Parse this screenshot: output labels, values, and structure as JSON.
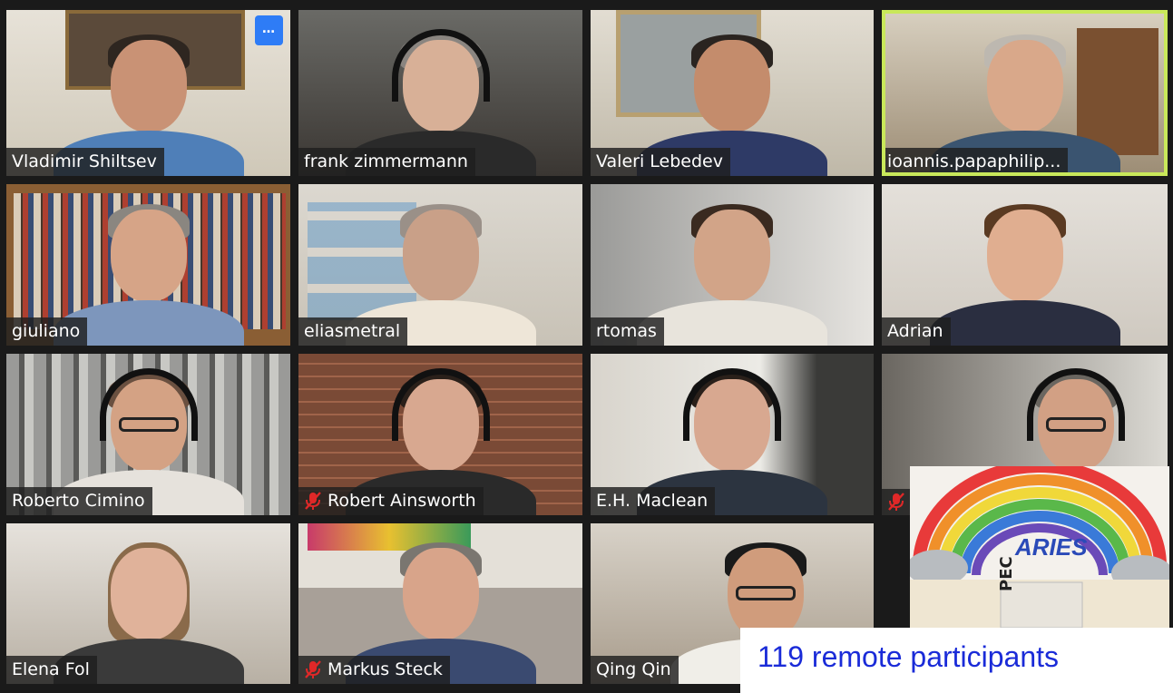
{
  "meeting": {
    "more_button_label": "…",
    "active_speaker_color": "#c9e85a",
    "participants": [
      {
        "name": "Vladimir Shiltsev",
        "muted": false
      },
      {
        "name": "frank zimmermann",
        "muted": false
      },
      {
        "name": "Valeri Lebedev",
        "muted": false
      },
      {
        "name": "ioannis.papaphilip...",
        "muted": false,
        "active_speaker": true
      },
      {
        "name": "giuliano",
        "muted": false
      },
      {
        "name": "eliasmetral",
        "muted": false
      },
      {
        "name": "rtomas",
        "muted": false
      },
      {
        "name": "Adrian",
        "muted": false
      },
      {
        "name": "Roberto Cimino",
        "muted": false
      },
      {
        "name": "Robert Ainsworth",
        "muted": true
      },
      {
        "name": "E.H. Maclean",
        "muted": false
      },
      {
        "name": "",
        "muted": true
      },
      {
        "name": "Elena Fol",
        "muted": false
      },
      {
        "name": "Markus Steck",
        "muted": true
      },
      {
        "name": "Qing Qin",
        "muted": false
      }
    ]
  },
  "overlay": {
    "logo_text": "ARIES",
    "logo_partial_text": "PEC",
    "remote_participants_text": "119 remote participants"
  }
}
